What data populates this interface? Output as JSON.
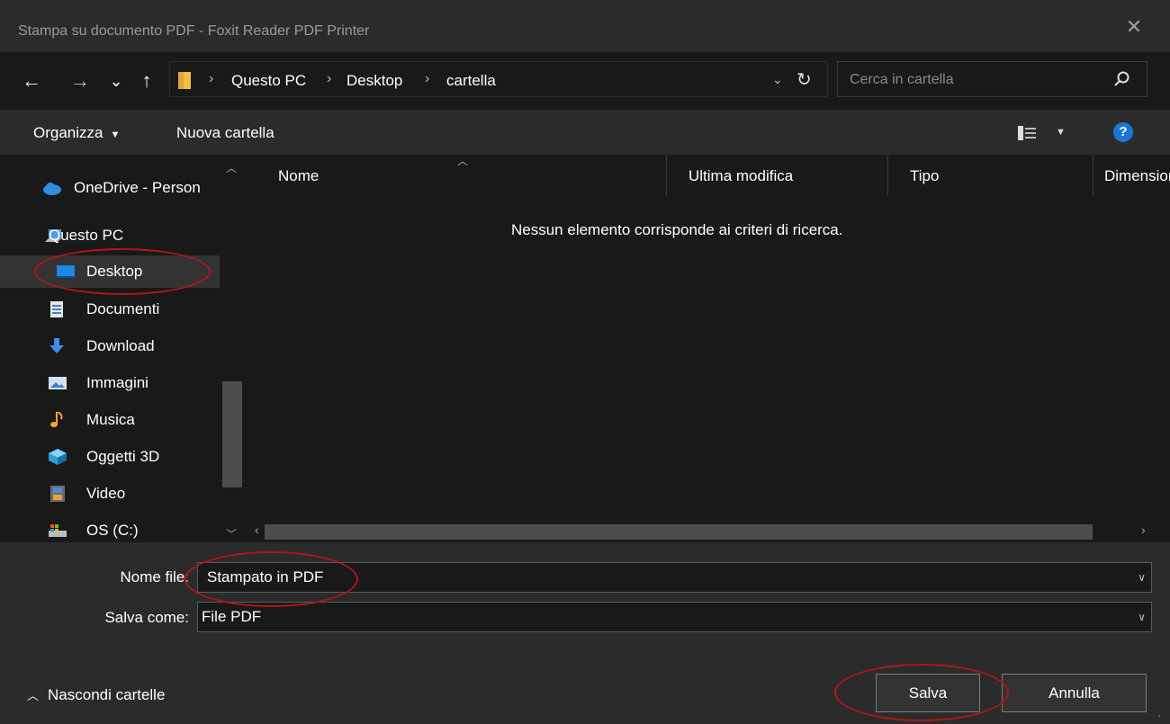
{
  "window": {
    "title": "Stampa su documento PDF - Foxit Reader PDF Printer"
  },
  "nav_buttons": {
    "back": "←",
    "forward": "→",
    "recent": "⌄",
    "up": "↑"
  },
  "breadcrumb": {
    "items": [
      "Questo PC",
      "Desktop",
      "cartella"
    ],
    "separator": "›"
  },
  "search": {
    "placeholder": "Cerca in cartella"
  },
  "toolbar": {
    "organize": "Organizza",
    "new_folder": "Nuova cartella",
    "help": "?"
  },
  "sidebar": {
    "items": [
      {
        "label": "OneDrive - Person",
        "icon": "cloud-icon"
      },
      {
        "label": "Questo PC",
        "icon": "computer-icon"
      },
      {
        "label": "Desktop",
        "icon": "desktop-icon",
        "selected": true
      },
      {
        "label": "Documenti",
        "icon": "document-icon"
      },
      {
        "label": "Download",
        "icon": "download-icon"
      },
      {
        "label": "Immagini",
        "icon": "image-icon"
      },
      {
        "label": "Musica",
        "icon": "music-icon"
      },
      {
        "label": "Oggetti 3D",
        "icon": "cube-icon"
      },
      {
        "label": "Video",
        "icon": "film-icon"
      },
      {
        "label": "OS (C:)",
        "icon": "drive-icon"
      }
    ]
  },
  "columns": [
    "Nome",
    "Ultima modifica",
    "Tipo",
    "Dimensior"
  ],
  "list": {
    "empty_message": "Nessun elemento corrisponde ai criteri di ricerca."
  },
  "form": {
    "filename_label": "Nome file:",
    "filename_value": "Stampato in PDF",
    "savetype_label": "Salva come:",
    "savetype_value": "File PDF"
  },
  "footer": {
    "hide_folders": "Nascondi cartelle",
    "save": "Salva",
    "cancel": "Annulla"
  },
  "colors": {
    "accent": "#1a78d4",
    "annotation": "#b0151c",
    "folder": "#f0c040"
  }
}
